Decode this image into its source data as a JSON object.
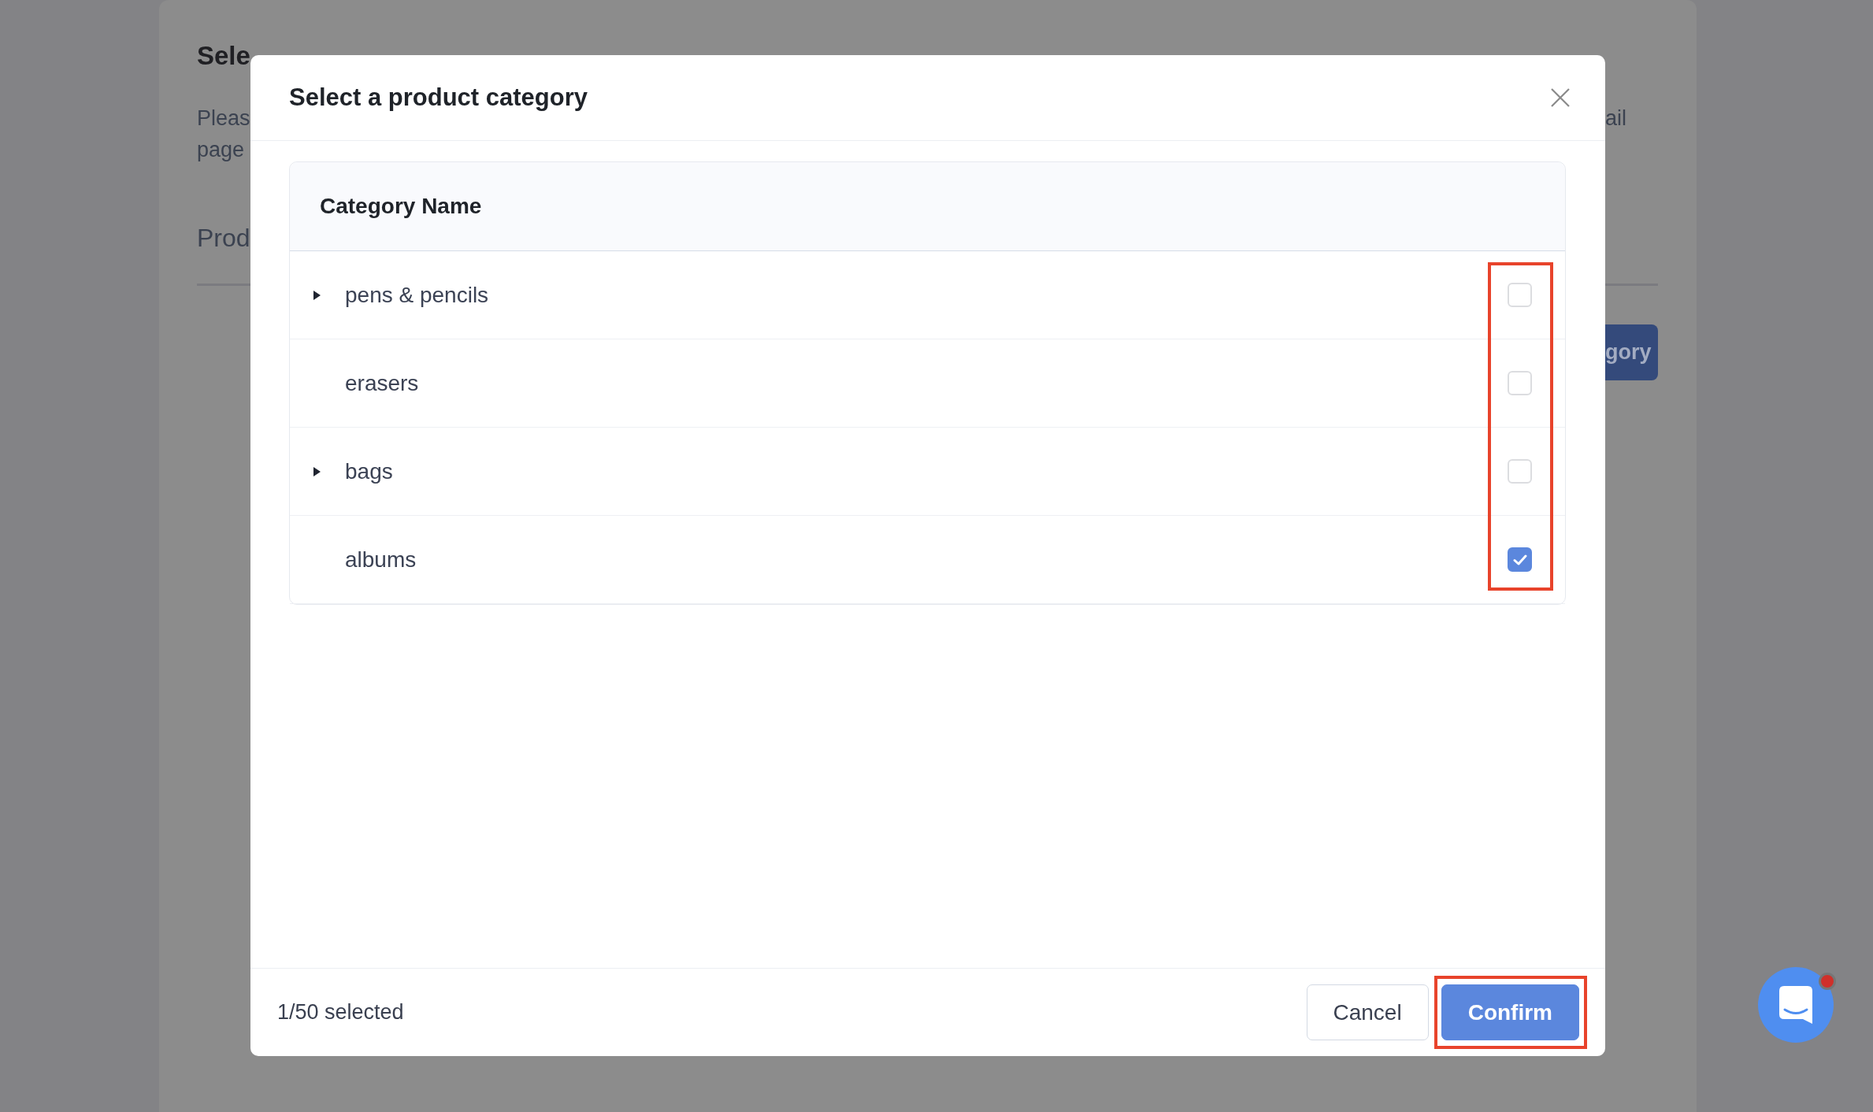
{
  "background_page": {
    "title": "Sele",
    "description_lines": [
      "Pleas",
      "page"
    ],
    "section_heading": "Prod",
    "description_line_end": "ail",
    "action_button": "gory"
  },
  "dialog": {
    "title": "Select a product category",
    "table": {
      "columns": [
        {
          "label": "Category Name"
        }
      ],
      "checkbox_column_highlighted": true,
      "rows": [
        {
          "name": "pens & pencils",
          "expandable": true,
          "expanded": false,
          "checked": false
        },
        {
          "name": "erasers",
          "expandable": false,
          "checked": false
        },
        {
          "name": "bags",
          "expandable": true,
          "expanded": false,
          "checked": false
        },
        {
          "name": "albums",
          "expandable": false,
          "checked": true
        }
      ]
    },
    "footer": {
      "selection_count": "1/50 selected",
      "buttons": [
        {
          "label": "Cancel",
          "kind": "secondary",
          "highlighted": false
        },
        {
          "label": "Confirm",
          "kind": "primary",
          "highlighted": true
        }
      ]
    }
  },
  "chat_widget": {
    "unread": true
  }
}
